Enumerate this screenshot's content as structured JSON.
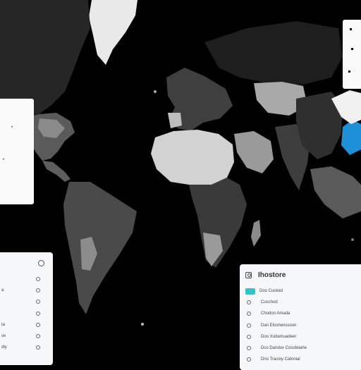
{
  "map": {
    "ocean_color": "#000000",
    "land_color": "#bfc0bf",
    "highlight_color": "#1e90d8"
  },
  "legend": {
    "title": "Ihostore",
    "items": [
      {
        "label": "Doo Cucked",
        "swatch_color": "#2bc6c9",
        "icon": "swatch"
      },
      {
        "label": "Cuschod",
        "icon": "dot-icon"
      },
      {
        "label": "Chodon Amada",
        "icon": "dot-icon"
      },
      {
        "label": "Dan Eloshenssoon",
        "icon": "dot-icon"
      },
      {
        "label": "Doo Xodamuadeer",
        "icon": "dot-icon"
      },
      {
        "label": "Dco Dandov Cosoteiahe",
        "icon": "dot-icon"
      },
      {
        "label": "Dno Tracioy Catonial",
        "icon": "dot-icon"
      }
    ]
  },
  "side_list": {
    "rows": [
      {
        "label": ""
      },
      {
        "label": "a"
      },
      {
        "label": ""
      },
      {
        "label": ""
      },
      {
        "label": "ta"
      },
      {
        "label": "ve"
      },
      {
        "label": "dly"
      }
    ]
  },
  "edge_panel": {
    "glyph": "•"
  }
}
